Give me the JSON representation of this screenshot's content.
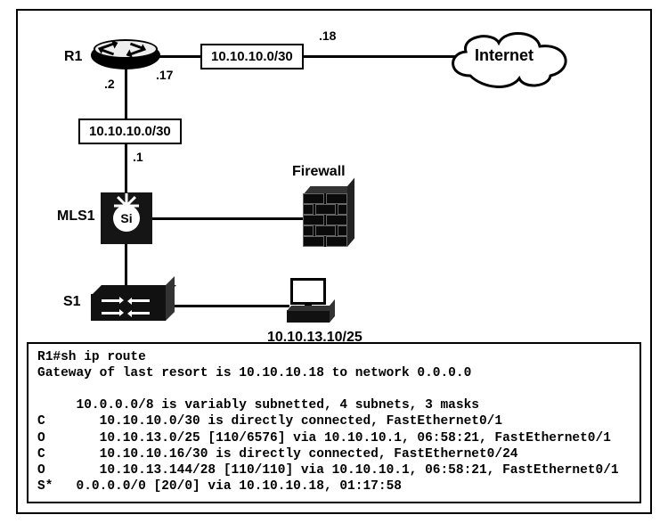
{
  "devices": {
    "r1_label": "R1",
    "mls1_label": "MLS1",
    "s1_label": "S1",
    "firewall_label": "Firewall",
    "internet_label": "Internet",
    "pc_address": "10.10.13.10/25"
  },
  "links": {
    "r1_internet_subnet": "10.10.10.0/30",
    "r1_internet_local": ".17",
    "r1_internet_remote": ".18",
    "r1_mls_subnet": "10.10.10.0/30",
    "r1_mls_r1side": ".2",
    "r1_mls_mlsside": ".1"
  },
  "cli": {
    "prompt": "R1#sh ip route",
    "gateway": "Gateway of last resort is 10.10.10.18 to network 0.0.0.0",
    "summary": "     10.0.0.0/8 is variably subnetted, 4 subnets, 3 masks",
    "r1": "C       10.10.10.0/30 is directly connected, FastEthernet0/1",
    "r2": "O       10.10.13.0/25 [110/6576] via 10.10.10.1, 06:58:21, FastEthernet0/1",
    "r3": "C       10.10.10.16/30 is directly connected, FastEthernet0/24",
    "r4": "O       10.10.13.144/28 [110/110] via 10.10.10.1, 06:58:21, FastEthernet0/1",
    "r5": "S*   0.0.0.0/0 [20/0] via 10.10.10.18, 01:17:58"
  },
  "chart_data": {
    "type": "table",
    "title": "R1 routing table",
    "gateway_of_last_resort": {
      "next_hop": "10.10.10.18",
      "network": "0.0.0.0"
    },
    "parent_summary": {
      "network": "10.0.0.0/8",
      "subnets": 4,
      "masks": 3
    },
    "routes": [
      {
        "code": "C",
        "prefix": "10.10.10.0/30",
        "via": null,
        "metric": null,
        "age": null,
        "interface": "FastEthernet0/1"
      },
      {
        "code": "O",
        "prefix": "10.10.13.0/25",
        "via": "10.10.10.1",
        "metric": "110/6576",
        "age": "06:58:21",
        "interface": "FastEthernet0/1"
      },
      {
        "code": "C",
        "prefix": "10.10.10.16/30",
        "via": null,
        "metric": null,
        "age": null,
        "interface": "FastEthernet0/24"
      },
      {
        "code": "O",
        "prefix": "10.10.13.144/28",
        "via": "10.10.10.1",
        "metric": "110/110",
        "age": "06:58:21",
        "interface": "FastEthernet0/1"
      },
      {
        "code": "S*",
        "prefix": "0.0.0.0/0",
        "via": "10.10.10.18",
        "metric": "20/0",
        "age": "01:17:58",
        "interface": null
      }
    ],
    "topology": {
      "nodes": [
        "R1",
        "MLS1",
        "S1",
        "Firewall",
        "Internet",
        "PC(10.10.13.10/25)"
      ],
      "edges": [
        {
          "a": "R1",
          "b": "Internet",
          "subnet": "10.10.10.0/30",
          "a_ip": ".17",
          "b_ip": ".18"
        },
        {
          "a": "R1",
          "b": "MLS1",
          "subnet": "10.10.10.0/30",
          "a_ip": ".2",
          "b_ip": ".1"
        },
        {
          "a": "MLS1",
          "b": "Firewall"
        },
        {
          "a": "MLS1",
          "b": "S1"
        },
        {
          "a": "S1",
          "b": "PC(10.10.13.10/25)"
        }
      ]
    }
  }
}
